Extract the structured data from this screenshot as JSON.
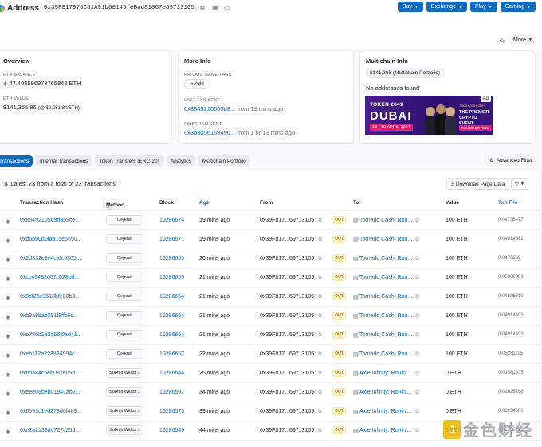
{
  "header": {
    "title": "Address",
    "address": "0x39F817976C51A91b60145feBad81067e69713105",
    "buttons": [
      "Buy",
      "Exchange",
      "Play",
      "Gaming"
    ],
    "more_label": "More"
  },
  "overview": {
    "title": "Overview",
    "eth_balance_label": "ETH BALANCE",
    "eth_balance": "47.405596973765848 ETH",
    "eth_value_label": "ETH VALUE",
    "eth_value": "$141,355.86",
    "eth_value_rate": "(@ $2,981.84/ETH)"
  },
  "more_info": {
    "title": "More Info",
    "tags_label": "PRIVATE NAME TAGS",
    "add_label": "+ Add",
    "last_label": "LAST TXN SENT",
    "last_hash": "0x8849210569d8...",
    "last_time": "from 19 mins ago",
    "first_label": "FIRST TXN SENT",
    "first_hash": "0x363056169496...",
    "first_time": "from 1 hr 13 mins ago"
  },
  "multichain": {
    "title": "Multichain Info",
    "portfolio": "$141,365 (Multichain Portfolio)",
    "no_addresses": "No addresses found"
  },
  "ad": {
    "badge": "Ad",
    "line1": "TOKEN 2049",
    "line2": "DUBAI",
    "dates": "18 - 19 APRIL 2024",
    "stats": "7,500+ 200+ 300+",
    "tagline": "THE PREMIER CRYPTO EVENT",
    "cta": "REGISTER NOW"
  },
  "tabs": [
    "Transactions",
    "Internal Transactions",
    "Token Transfers (ERC-20)",
    "Analytics",
    "Multichain Portfolio"
  ],
  "advanced_filter": "Advanced Filter",
  "latest_text": "Latest 23 from a total of 23 transactions",
  "download_label": "Download Page Data",
  "columns": [
    "Transaction Hash",
    "Method",
    "Block",
    "Age",
    "From",
    "To",
    "Value",
    "Txn Fee"
  ],
  "rows": [
    {
      "hash": "0x8849210569d859ce...",
      "method": "Deposit",
      "block": "19286674",
      "age": "19 mins ago",
      "from": "0x39F817...69713105",
      "dir": "OUT",
      "to": "Tornado.Cash: Rou...",
      "value": "100 ETH",
      "fee": "0.04735477"
    },
    {
      "hash": "0xd6bb0d0faa15e6550...",
      "method": "Deposit",
      "block": "19286671",
      "age": "19 mins ago",
      "from": "0x39F817...69713105",
      "dir": "OUT",
      "to": "Tornado.Cash: Rou...",
      "value": "100 ETH",
      "fee": "0.04614682"
    },
    {
      "hash": "0x2d332e8e4cafc6365...",
      "method": "Deposit",
      "block": "19286669",
      "age": "20 mins ago",
      "from": "0x39F817...69713105",
      "dir": "OUT",
      "to": "Tornado.Cash: Rou...",
      "value": "100 ETH",
      "fee": "0.0476939"
    },
    {
      "hash": "0xcc45482667c628bd...",
      "method": "Deposit",
      "block": "19286665",
      "age": "21 mins ago",
      "from": "0x39F817...69713105",
      "dir": "OUT",
      "to": "Tornado.Cash: Rou...",
      "value": "100 ETH",
      "fee": "0.05302389"
    },
    {
      "hash": "0x9cf26e9613bfe80b3...",
      "method": "Deposit",
      "block": "19286664",
      "age": "21 mins ago",
      "from": "0x39F817...69713105",
      "dir": "OUT",
      "to": "Tornado.Cash: Rou...",
      "value": "100 ETH",
      "fee": "0.04886819"
    },
    {
      "hash": "0xb9a9bab291f8ffc6c...",
      "method": "Deposit",
      "block": "19286664",
      "age": "21 mins ago",
      "from": "0x39F817...69713105",
      "dir": "OUT",
      "to": "Tornado.Cash: Rou...",
      "value": "100 ETH",
      "fee": "0.04914499"
    },
    {
      "hash": "0xe786b1a2d56f0ad41...",
      "method": "Deposit",
      "block": "19286664",
      "age": "21 mins ago",
      "from": "0x39F817...69713105",
      "dir": "OUT",
      "to": "Tornado.Cash: Rou...",
      "value": "100 ETH",
      "fee": "0.04914499"
    },
    {
      "hash": "0xeb112a223824994c...",
      "method": "Deposit",
      "block": "19286657",
      "age": "22 mins ago",
      "from": "0x39F817...69713105",
      "dir": "OUT",
      "to": "Tornado.Cash: Rou...",
      "value": "100 ETH",
      "fee": "0.05281195"
    },
    {
      "hash": "0xbda84c6eb087e05b...",
      "method": "Submit Withdr...",
      "block": "19286644",
      "age": "25 mins ago",
      "from": "0x39F817...69713105",
      "dir": "OUT",
      "to": "Axie Infinity: Ronin ...",
      "value": "0 ETH",
      "fee": "0.01581635"
    },
    {
      "hash": "0xeee05beb01947ab2...",
      "method": "Submit Withdr...",
      "block": "19286597",
      "age": "34 mins ago",
      "from": "0x39F817...69713105",
      "dir": "OUT",
      "to": "Axie Infinity: Ronin ...",
      "value": "0 ETH",
      "fee": "0.02629268"
    },
    {
      "hash": "0x6593c1ed278d6f489...",
      "method": "Submit Withdr...",
      "block": "19286575",
      "age": "39 mins ago",
      "from": "0x39F817...69713105",
      "dir": "OUT",
      "to": "Axie Infinity: Ronin ...",
      "value": "0 ETH",
      "fee": "0.03294683"
    },
    {
      "hash": "0xe2a2139de727c256...",
      "method": "Submit Withdr...",
      "block": "19286549",
      "age": "44 mins ago",
      "from": "0x39F817...69713105",
      "dir": "OUT",
      "to": "Axie Infinity: Ronin ...",
      "value": "0 ETH",
      "fee": "0.02783273"
    }
  ],
  "watermark": "金色财经"
}
